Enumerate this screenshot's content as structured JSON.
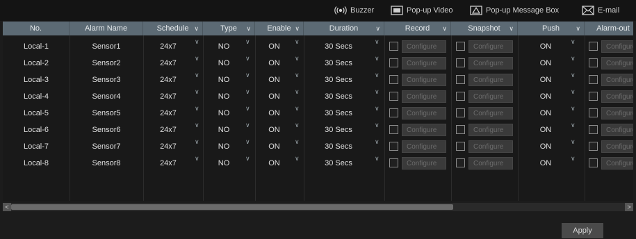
{
  "notify_options": [
    {
      "label": "Buzzer",
      "icon": "buzzer-icon"
    },
    {
      "label": "Pop-up Video",
      "icon": "popup-video-icon"
    },
    {
      "label": "Pop-up Message Box",
      "icon": "popup-message-icon"
    },
    {
      "label": "E-mail",
      "icon": "email-icon"
    }
  ],
  "columns": [
    "No.",
    "Alarm Name",
    "Schedule",
    "Type",
    "Enable",
    "Duration",
    "Record",
    "Snapshot",
    "Push",
    "Alarm-out"
  ],
  "configure_label": "Configure",
  "rows": [
    {
      "no": "Local-1",
      "name": "Sensor1",
      "schedule": "24x7",
      "type": "NO",
      "enable": "ON",
      "duration": "30 Secs",
      "push": "ON"
    },
    {
      "no": "Local-2",
      "name": "Sensor2",
      "schedule": "24x7",
      "type": "NO",
      "enable": "ON",
      "duration": "30 Secs",
      "push": "ON"
    },
    {
      "no": "Local-3",
      "name": "Sensor3",
      "schedule": "24x7",
      "type": "NO",
      "enable": "ON",
      "duration": "30 Secs",
      "push": "ON"
    },
    {
      "no": "Local-4",
      "name": "Sensor4",
      "schedule": "24x7",
      "type": "NO",
      "enable": "ON",
      "duration": "30 Secs",
      "push": "ON"
    },
    {
      "no": "Local-5",
      "name": "Sensor5",
      "schedule": "24x7",
      "type": "NO",
      "enable": "ON",
      "duration": "30 Secs",
      "push": "ON"
    },
    {
      "no": "Local-6",
      "name": "Sensor6",
      "schedule": "24x7",
      "type": "NO",
      "enable": "ON",
      "duration": "30 Secs",
      "push": "ON"
    },
    {
      "no": "Local-7",
      "name": "Sensor7",
      "schedule": "24x7",
      "type": "NO",
      "enable": "ON",
      "duration": "30 Secs",
      "push": "ON"
    },
    {
      "no": "Local-8",
      "name": "Sensor8",
      "schedule": "24x7",
      "type": "NO",
      "enable": "ON",
      "duration": "30 Secs",
      "push": "ON"
    }
  ],
  "scrollbar": {
    "left_label": "<",
    "right_label": ">",
    "position_fraction": 0.0,
    "visible_fraction": 0.72
  },
  "apply_label": "Apply",
  "colors": {
    "header_bg": "#5c6a74",
    "background": "#1c1c1c",
    "topbar_bg": "#141414"
  }
}
